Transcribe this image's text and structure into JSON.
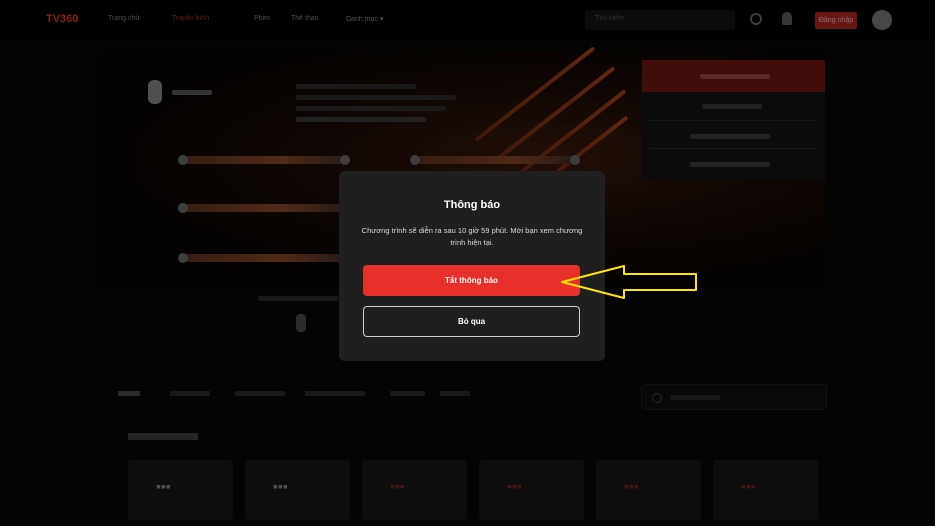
{
  "nav": {
    "logo": "TV360",
    "items": [
      "Trang chủ",
      "Truyền hình",
      "Phim",
      "Thể thao",
      "Danh mục ▾"
    ],
    "search_placeholder": "Tìm kiếm",
    "login_label": "Đăng nhập"
  },
  "modal": {
    "title": "Thông báo",
    "message": "Chương trình sẽ diễn ra sau 10 giờ 59 phút. Mời bạn xem chương trình hiện tại.",
    "primary_label": "Tắt thông báo",
    "secondary_label": "Bỏ qua"
  },
  "colors": {
    "accent": "#e8302a",
    "modal_bg": "#1f1f1f",
    "arrow": "#ffe600"
  }
}
